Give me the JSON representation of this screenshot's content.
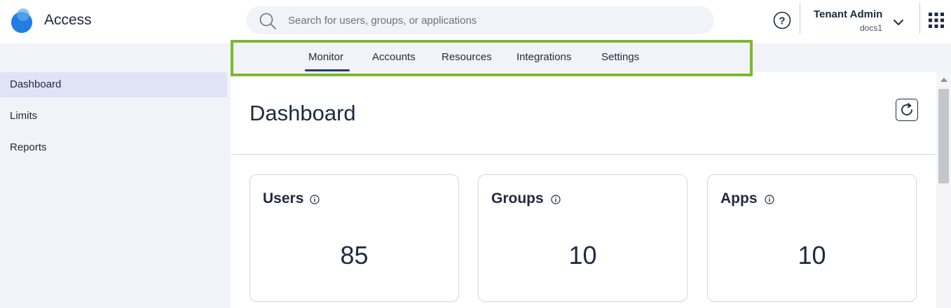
{
  "app": {
    "title": "Access",
    "logo_icon": "access-logo"
  },
  "search": {
    "placeholder": "Search for users, groups, or applications",
    "value": ""
  },
  "user": {
    "name": "Tenant Admin",
    "tenant": "docs1"
  },
  "nav": {
    "tabs": [
      {
        "label": "Monitor",
        "active": true
      },
      {
        "label": "Accounts"
      },
      {
        "label": "Resources"
      },
      {
        "label": "Integrations"
      },
      {
        "label": "Settings"
      }
    ],
    "highlight_color": "#7cb82f"
  },
  "sidebar": {
    "items": [
      {
        "label": "Dashboard",
        "active": true
      },
      {
        "label": "Limits"
      },
      {
        "label": "Reports"
      }
    ]
  },
  "main": {
    "title": "Dashboard",
    "cards": [
      {
        "title": "Users",
        "value": "85",
        "icon": "info-icon"
      },
      {
        "title": "Groups",
        "value": "10",
        "icon": "info-icon"
      },
      {
        "title": "Apps",
        "value": "10",
        "icon": "info-icon"
      }
    ]
  },
  "colors": {
    "accent": "#1f3e74",
    "sidebar_bg": "#f2f3f8",
    "active_item_bg": "#dfe3f5",
    "logo_blue": "#1a73d9"
  }
}
